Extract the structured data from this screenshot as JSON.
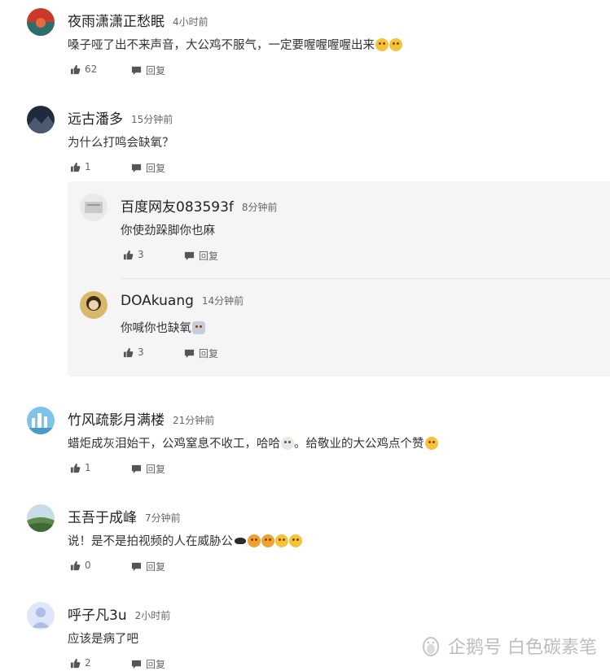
{
  "comments": [
    {
      "name": "夜雨潇潇正愁眠",
      "time": "4小时前",
      "text": "嗓子哑了出不来声音，大公鸡不服气，一定要喔喔喔喔出来",
      "likes": "62",
      "reply_label": "回复"
    },
    {
      "name": "远古潘多",
      "time": "15分钟前",
      "text": "为什么打鸣会缺氧？",
      "likes": "1",
      "reply_label": "回复",
      "replies": [
        {
          "name": "百度网友083593f",
          "time": "8分钟前",
          "text": "你使劲跺脚你也麻",
          "likes": "3",
          "reply_label": "回复"
        },
        {
          "name": "DOAkuang",
          "time": "14分钟前",
          "text": "你喊你也缺氧",
          "likes": "3",
          "reply_label": "回复"
        }
      ]
    },
    {
      "name": "竹风疏影月满楼",
      "time": "21分钟前",
      "text": "蜡炬成灰泪始干，公鸡窒息不收工，哈哈",
      "text2": "。给敬业的大公鸡点个赞",
      "likes": "1",
      "reply_label": "回复"
    },
    {
      "name": "玉吾于成峰",
      "time": "7分钟前",
      "text": "说！是不是拍视频的人在威胁公",
      "likes": "0",
      "reply_label": "回复"
    },
    {
      "name": "呼子凡3u",
      "time": "2小时前",
      "text": "应该是病了吧",
      "likes": "2",
      "reply_label": "回复"
    }
  ],
  "watermark": "企鹅号 白色碳素笔",
  "colors": {
    "text": "#222222",
    "meta": "#666666",
    "reply_bg": "#f5f5f5",
    "watermark": "#bdbdbd"
  }
}
